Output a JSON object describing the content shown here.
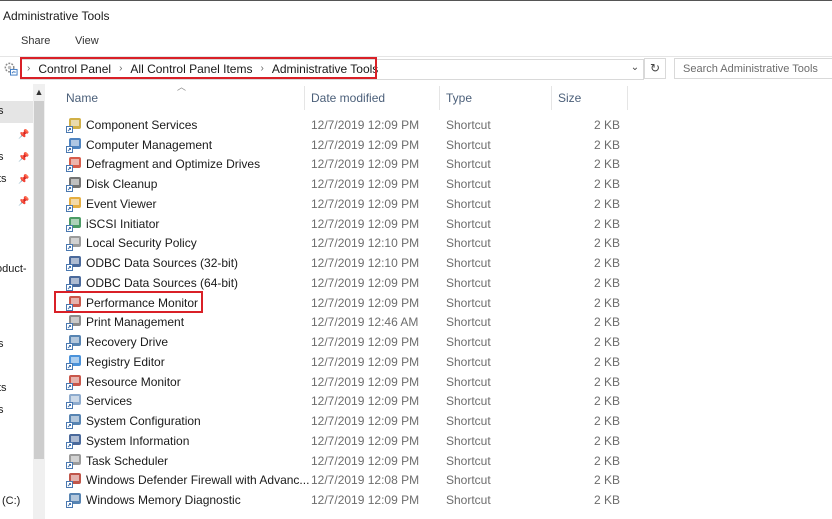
{
  "window": {
    "title": "Administrative Tools"
  },
  "ribbon": {
    "tabs": [
      "Share",
      "View"
    ]
  },
  "address_bar": {
    "crumbs": [
      "Control Panel",
      "All Control Panel Items",
      "Administrative Tools"
    ],
    "separator": "›",
    "dropdown_glyph": "⌄",
    "refresh_glyph": "↻"
  },
  "search": {
    "placeholder": "Search Administrative Tools",
    "value": ""
  },
  "nav_pane": {
    "fragments": [
      "s",
      "s",
      "ts",
      "oduct-",
      "s",
      "ts",
      "s",
      "(C:)"
    ]
  },
  "columns": {
    "name": "Name",
    "date": "Date modified",
    "type": "Type",
    "size": "Size"
  },
  "files": [
    {
      "name": "Component Services",
      "date": "12/7/2019 12:09 PM",
      "type": "Shortcut",
      "size": "2 KB",
      "icon": "component-services-icon",
      "color": "#c9a227"
    },
    {
      "name": "Computer Management",
      "date": "12/7/2019 12:09 PM",
      "type": "Shortcut",
      "size": "2 KB",
      "icon": "computer-management-icon",
      "color": "#2f6fb6"
    },
    {
      "name": "Defragment and Optimize Drives",
      "date": "12/7/2019 12:09 PM",
      "type": "Shortcut",
      "size": "2 KB",
      "icon": "defragment-icon",
      "color": "#d0402b"
    },
    {
      "name": "Disk Cleanup",
      "date": "12/7/2019 12:09 PM",
      "type": "Shortcut",
      "size": "2 KB",
      "icon": "disk-cleanup-icon",
      "color": "#5a5a5a"
    },
    {
      "name": "Event Viewer",
      "date": "12/7/2019 12:09 PM",
      "type": "Shortcut",
      "size": "2 KB",
      "icon": "event-viewer-icon",
      "color": "#e0a020"
    },
    {
      "name": "iSCSI Initiator",
      "date": "12/7/2019 12:09 PM",
      "type": "Shortcut",
      "size": "2 KB",
      "icon": "iscsi-initiator-icon",
      "color": "#2c8a4a"
    },
    {
      "name": "Local Security Policy",
      "date": "12/7/2019 12:10 PM",
      "type": "Shortcut",
      "size": "2 KB",
      "icon": "local-security-policy-icon",
      "color": "#8a8a8a"
    },
    {
      "name": "ODBC Data Sources (32-bit)",
      "date": "12/7/2019 12:10 PM",
      "type": "Shortcut",
      "size": "2 KB",
      "icon": "odbc-icon",
      "color": "#2a4f8a"
    },
    {
      "name": "ODBC Data Sources (64-bit)",
      "date": "12/7/2019 12:09 PM",
      "type": "Shortcut",
      "size": "2 KB",
      "icon": "odbc-icon",
      "color": "#2a4f8a"
    },
    {
      "name": "Performance Monitor",
      "date": "12/7/2019 12:09 PM",
      "type": "Shortcut",
      "size": "2 KB",
      "icon": "performance-monitor-icon",
      "color": "#c0392b"
    },
    {
      "name": "Print Management",
      "date": "12/7/2019 12:46 AM",
      "type": "Shortcut",
      "size": "2 KB",
      "icon": "print-management-icon",
      "color": "#777777"
    },
    {
      "name": "Recovery Drive",
      "date": "12/7/2019 12:09 PM",
      "type": "Shortcut",
      "size": "2 KB",
      "icon": "recovery-drive-icon",
      "color": "#3a6ea5"
    },
    {
      "name": "Registry Editor",
      "date": "12/7/2019 12:09 PM",
      "type": "Shortcut",
      "size": "2 KB",
      "icon": "registry-editor-icon",
      "color": "#2a7fd4"
    },
    {
      "name": "Resource Monitor",
      "date": "12/7/2019 12:09 PM",
      "type": "Shortcut",
      "size": "2 KB",
      "icon": "resource-monitor-icon",
      "color": "#c0392b"
    },
    {
      "name": "Services",
      "date": "12/7/2019 12:09 PM",
      "type": "Shortcut",
      "size": "2 KB",
      "icon": "services-icon",
      "color": "#7a9cc4"
    },
    {
      "name": "System Configuration",
      "date": "12/7/2019 12:09 PM",
      "type": "Shortcut",
      "size": "2 KB",
      "icon": "system-configuration-icon",
      "color": "#3a6ea5"
    },
    {
      "name": "System Information",
      "date": "12/7/2019 12:09 PM",
      "type": "Shortcut",
      "size": "2 KB",
      "icon": "system-information-icon",
      "color": "#2a4f8a"
    },
    {
      "name": "Task Scheduler",
      "date": "12/7/2019 12:09 PM",
      "type": "Shortcut",
      "size": "2 KB",
      "icon": "task-scheduler-icon",
      "color": "#8a8a8a"
    },
    {
      "name": "Windows Defender Firewall with Advanc...",
      "date": "12/7/2019 12:08 PM",
      "type": "Shortcut",
      "size": "2 KB",
      "icon": "firewall-icon",
      "color": "#b5382a"
    },
    {
      "name": "Windows Memory Diagnostic",
      "date": "12/7/2019 12:09 PM",
      "type": "Shortcut",
      "size": "2 KB",
      "icon": "memory-diagnostic-icon",
      "color": "#3a6ea5"
    }
  ],
  "colors": {
    "highlight": "#d92027",
    "header_text": "#4c607a",
    "secondary_text": "#6d6d6d"
  }
}
